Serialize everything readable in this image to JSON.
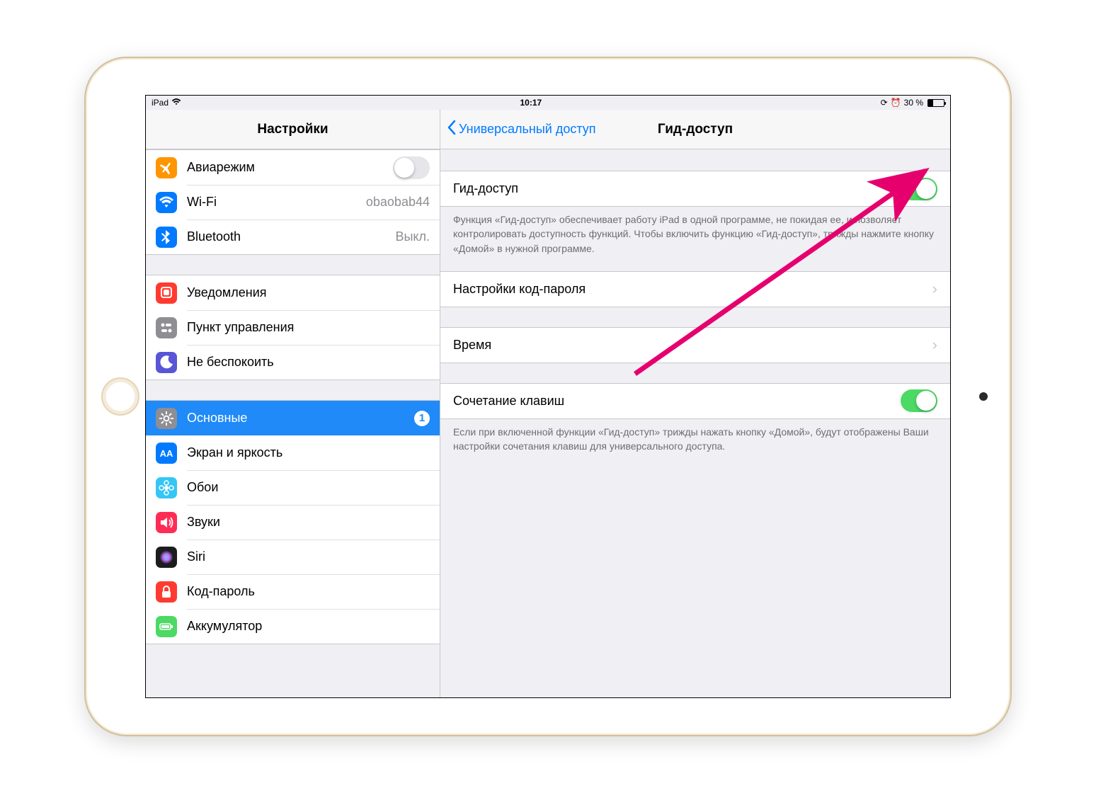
{
  "statusbar": {
    "device": "iPad",
    "time": "10:17",
    "battery_text": "30 %"
  },
  "sidebar": {
    "title": "Настройки",
    "groups": [
      [
        {
          "icon": "airplane",
          "color": "#ff9500",
          "label": "Авиарежим",
          "accessory": "toggle",
          "toggle_on": false
        },
        {
          "icon": "wifi",
          "color": "#007aff",
          "label": "Wi-Fi",
          "detail": "obaobab44"
        },
        {
          "icon": "bluetooth",
          "color": "#007aff",
          "label": "Bluetooth",
          "detail": "Выкл."
        }
      ],
      [
        {
          "icon": "bell",
          "color": "#ff3b30",
          "label": "Уведомления"
        },
        {
          "icon": "control",
          "color": "#8e8e93",
          "label": "Пункт управления"
        },
        {
          "icon": "moon",
          "color": "#5856d6",
          "label": "Не беспокоить"
        }
      ],
      [
        {
          "icon": "gear",
          "color": "#8e8e93",
          "label": "Основные",
          "selected": true,
          "badge": "1"
        },
        {
          "icon": "aa",
          "color": "#007aff",
          "label": "Экран и яркость"
        },
        {
          "icon": "flower",
          "color": "#34c6f4",
          "label": "Обои"
        },
        {
          "icon": "speaker",
          "color": "#ff2d55",
          "label": "Звуки"
        },
        {
          "icon": "siri",
          "color": "#1c1c1e",
          "label": "Siri"
        },
        {
          "icon": "lock",
          "color": "#ff3b30",
          "label": "Код-пароль"
        },
        {
          "icon": "battery",
          "color": "#4cd964",
          "label": "Аккумулятор"
        }
      ]
    ]
  },
  "detail": {
    "back_label": "Универсальный доступ",
    "title": "Гид-доступ",
    "rows": {
      "guided_access": {
        "label": "Гид-доступ",
        "on": true
      },
      "guided_footer": "Функция «Гид-доступ» обеспечивает работу iPad в одной программе, не покидая ее, и позволяет контролировать доступность функций. Чтобы включить функцию «Гид-доступ», трижды нажмите кнопку «Домой» в нужной программе.",
      "passcode": {
        "label": "Настройки код-пароля"
      },
      "time": {
        "label": "Время"
      },
      "shortcut": {
        "label": "Сочетание клавиш",
        "on": true
      },
      "shortcut_footer": "Если при включенной функции «Гид-доступ» трижды нажать кнопку «Домой», будут отображены Ваши настройки сочетания клавиш для универсального доступа."
    }
  }
}
